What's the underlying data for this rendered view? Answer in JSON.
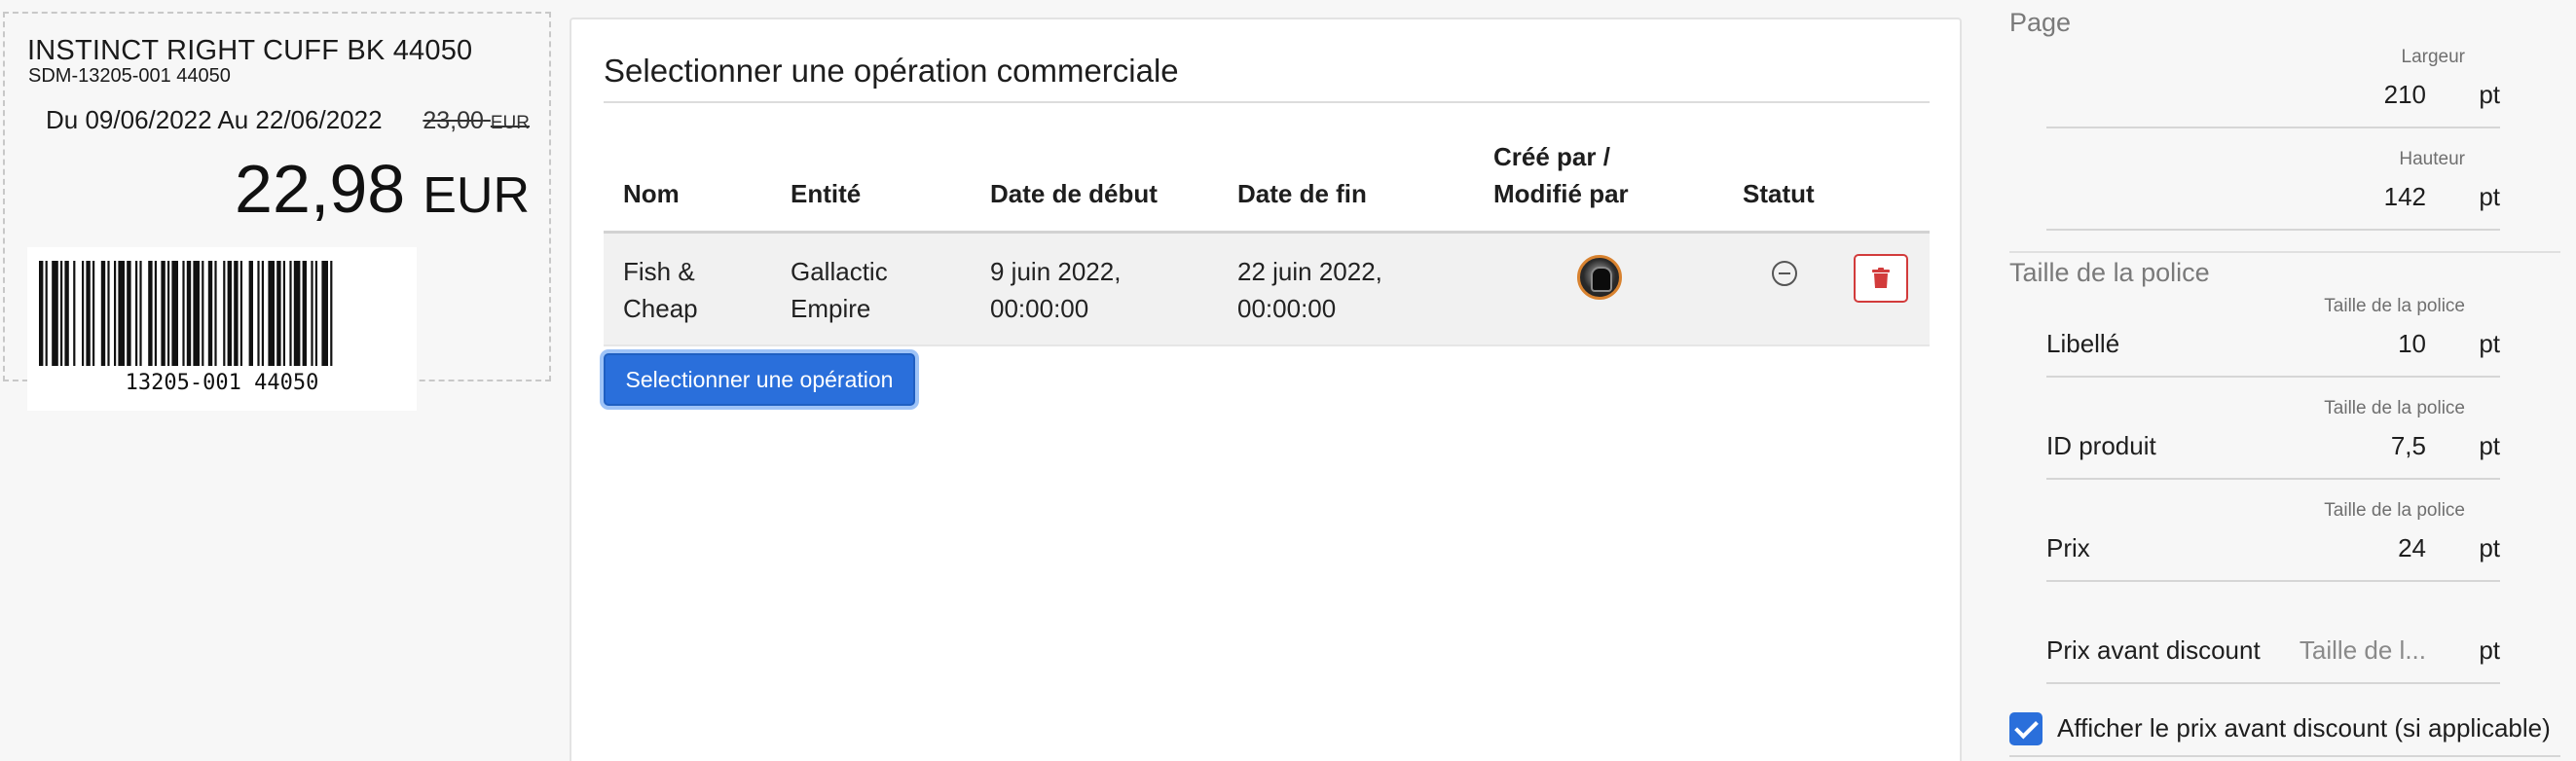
{
  "label_preview": {
    "product_name": "INSTINCT RIGHT CUFF BK 44050",
    "product_id": "SDM-13205-001 44050",
    "dates": "Du 09/06/2022 Au 22/06/2022",
    "old_price": "23,00",
    "old_currency": "EUR",
    "price": "22,98",
    "currency": "EUR",
    "barcode_text": "13205-001 44050"
  },
  "operation_panel": {
    "title": "Selectionner une opération commerciale",
    "columns": {
      "name": "Nom",
      "entity": "Entité",
      "start": "Date de début",
      "end": "Date de fin",
      "created_by_1": "Créé par /",
      "created_by_2": "Modifié par",
      "status": "Statut"
    },
    "rows": [
      {
        "name_1": "Fish &",
        "name_2": "Cheap",
        "entity_1": "Gallactic",
        "entity_2": "Empire",
        "start_1": "9 juin 2022,",
        "start_2": "00:00:00",
        "end_1": "22 juin 2022,",
        "end_2": "00:00:00"
      }
    ],
    "select_button": "Selectionner une opération",
    "colors": {
      "primary": "#2a6fdb",
      "danger": "#d23b3b"
    }
  },
  "settings": {
    "page": {
      "title": "Page",
      "width": {
        "sub": "Largeur",
        "value": "210",
        "unit": "pt"
      },
      "height": {
        "sub": "Hauteur",
        "value": "142",
        "unit": "pt"
      }
    },
    "font_size": {
      "title": "Taille de la police",
      "fields": [
        {
          "sub": "Taille de la police",
          "label": "Libellé",
          "value": "10",
          "unit": "pt"
        },
        {
          "sub": "Taille de la police",
          "label": "ID produit",
          "value": "7,5",
          "unit": "pt"
        },
        {
          "sub": "Taille de la police",
          "label": "Prix",
          "value": "24",
          "unit": "pt"
        },
        {
          "label": "Prix avant discount",
          "placeholder": "Taille de l...",
          "unit": "pt"
        }
      ]
    },
    "show_old_price": {
      "label": "Afficher le prix avant discount (si applicable)",
      "checked": true
    }
  }
}
